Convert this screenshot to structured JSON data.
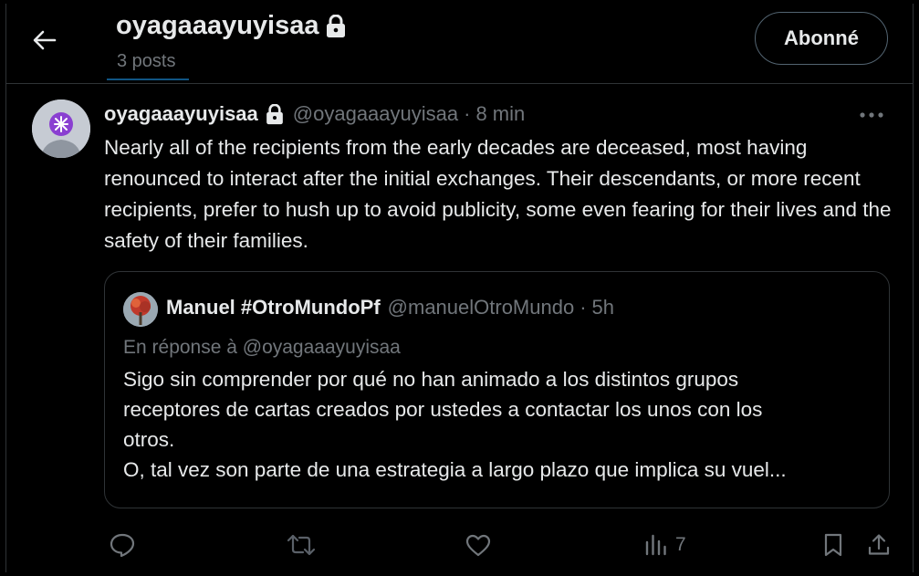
{
  "header": {
    "title": "oyagaaayuyisaa",
    "subtitle": "3 posts",
    "follow_label": "Abonné"
  },
  "tweet": {
    "display_name": "oyagaaayuyisaa",
    "handle": "@oyagaaayuyisaa",
    "separator": "·",
    "time": "8 min",
    "text": "Nearly all of the recipients from the early decades are deceased, most having renounced to interact after the initial exchanges. Their descendants, or more recent recipients, prefer to hush up to avoid publicity, some even fearing for their lives and the safety of their families.",
    "views_count": "7"
  },
  "quote": {
    "display_name": "Manuel #OtroMundoPf",
    "handle": "@manuelOtroMundo",
    "separator": "·",
    "time": "5h",
    "reply_to": "En réponse à @oyagaaayuyisaa",
    "lines": [
      "Sigo sin comprender por qué no han animado a los distintos grupos",
      "receptores de cartas creados por ustedes a contactar los unos con los",
      "otros.",
      "O, tal vez son parte de una estrategia a largo plazo que implica su vuel..."
    ]
  },
  "icons": {
    "back": "arrow-left-icon",
    "lock": "lock-icon",
    "more": "more-horizontal-icon",
    "reply": "reply-icon",
    "repost": "repost-icon",
    "like": "heart-icon",
    "views": "views-icon",
    "bookmark": "bookmark-icon",
    "share": "share-icon"
  },
  "colors": {
    "background": "#000000",
    "text": "#e7e9ea",
    "muted": "#71767b",
    "border": "#2f3336",
    "accent": "#1d9bf0"
  }
}
